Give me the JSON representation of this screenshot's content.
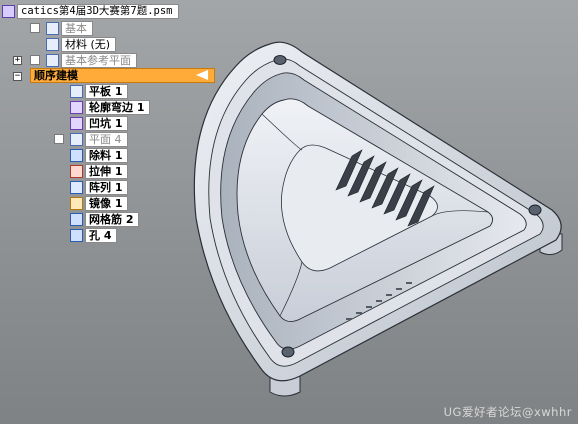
{
  "document": {
    "title": "catics第4届3D大赛第7题.psm"
  },
  "tree": {
    "base": "基本",
    "material": "材料 (无)",
    "base_ref_planes": "基本参考平面",
    "ordered_modeling": "顺序建模",
    "features": [
      {
        "label": "平板 1",
        "icon": "flange-plate-icon",
        "greyed": false
      },
      {
        "label": "轮廓弯边 1",
        "icon": "contour-flange-icon",
        "greyed": false
      },
      {
        "label": "凹坑 1",
        "icon": "dimple-icon",
        "greyed": false
      },
      {
        "label": "平面 4",
        "icon": "plane-icon",
        "greyed": true
      },
      {
        "label": "除料 1",
        "icon": "cutout-icon",
        "greyed": false
      },
      {
        "label": "拉伸 1",
        "icon": "extrude-icon",
        "greyed": false
      },
      {
        "label": "阵列 1",
        "icon": "pattern-icon",
        "greyed": false
      },
      {
        "label": "镜像 1",
        "icon": "mirror-icon",
        "greyed": false
      },
      {
        "label": "网格筋 2",
        "icon": "gusset-grid-icon",
        "greyed": false
      },
      {
        "label": "孔 4",
        "icon": "hole-icon",
        "greyed": false
      }
    ]
  },
  "watermark": "UG爱好者论坛@xwhhr",
  "colors": {
    "active_row": "#ffab3a",
    "model_face": "#d6dbe3",
    "model_edge": "#2b2f38",
    "background": "#9a9d9f"
  }
}
